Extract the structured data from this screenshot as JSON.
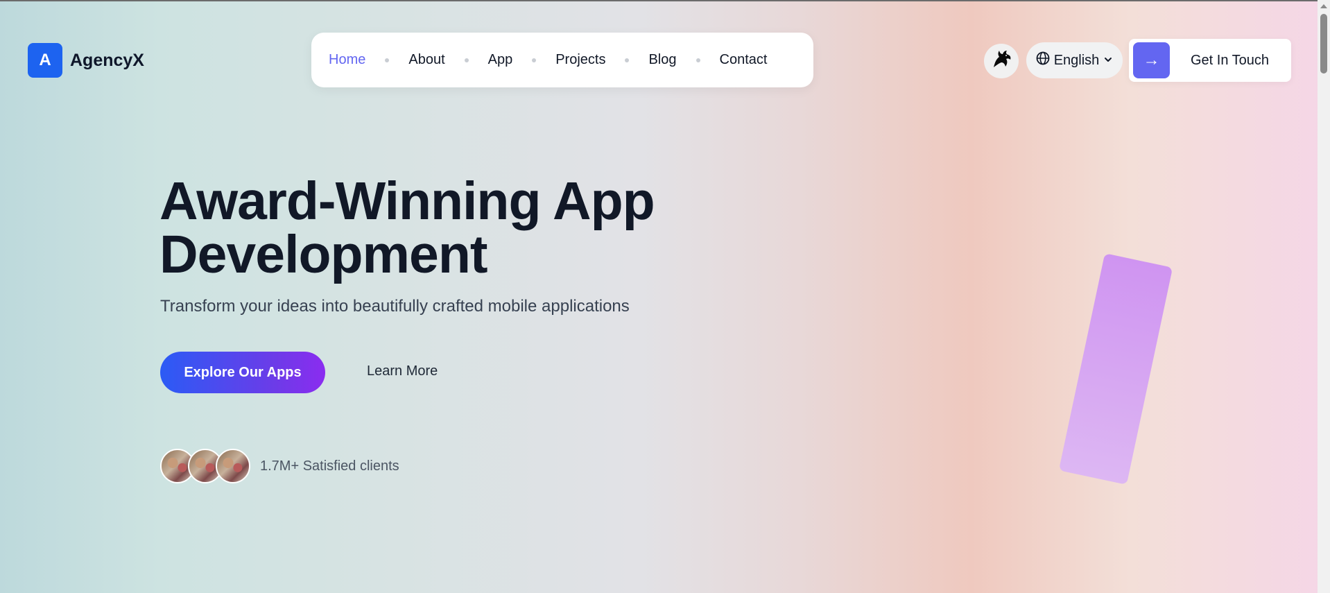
{
  "logo": {
    "mark": "A",
    "name": "AgencyX"
  },
  "nav": {
    "items": [
      {
        "label": "Home",
        "active": true
      },
      {
        "label": "About"
      },
      {
        "label": "App"
      },
      {
        "label": "Projects"
      },
      {
        "label": "Blog"
      },
      {
        "label": "Contact"
      }
    ]
  },
  "header": {
    "theme_icon": "dragon-icon",
    "language": {
      "icon": "globe-icon",
      "selected": "English",
      "chevron": "chevron-down-icon"
    },
    "cta": {
      "icon": "arrow-right-icon",
      "arrow_glyph": "→",
      "label": "Get In Touch"
    }
  },
  "hero": {
    "title_line1": "Award-Winning App",
    "title_line2": "Development",
    "subtitle": "Transform your ideas into beautifully crafted mobile applications",
    "primary_button": "Explore Our Apps",
    "secondary_button": "Learn More"
  },
  "clients": {
    "text": "1.7M+ Satisfied clients",
    "avatar_count": 3
  },
  "colors": {
    "accent": "#6366f1",
    "logo_blue": "#1d63f0",
    "button_gradient_start": "#2b5bf5",
    "button_gradient_end": "#8b2cf0",
    "deco_card": "#cf94f1"
  }
}
